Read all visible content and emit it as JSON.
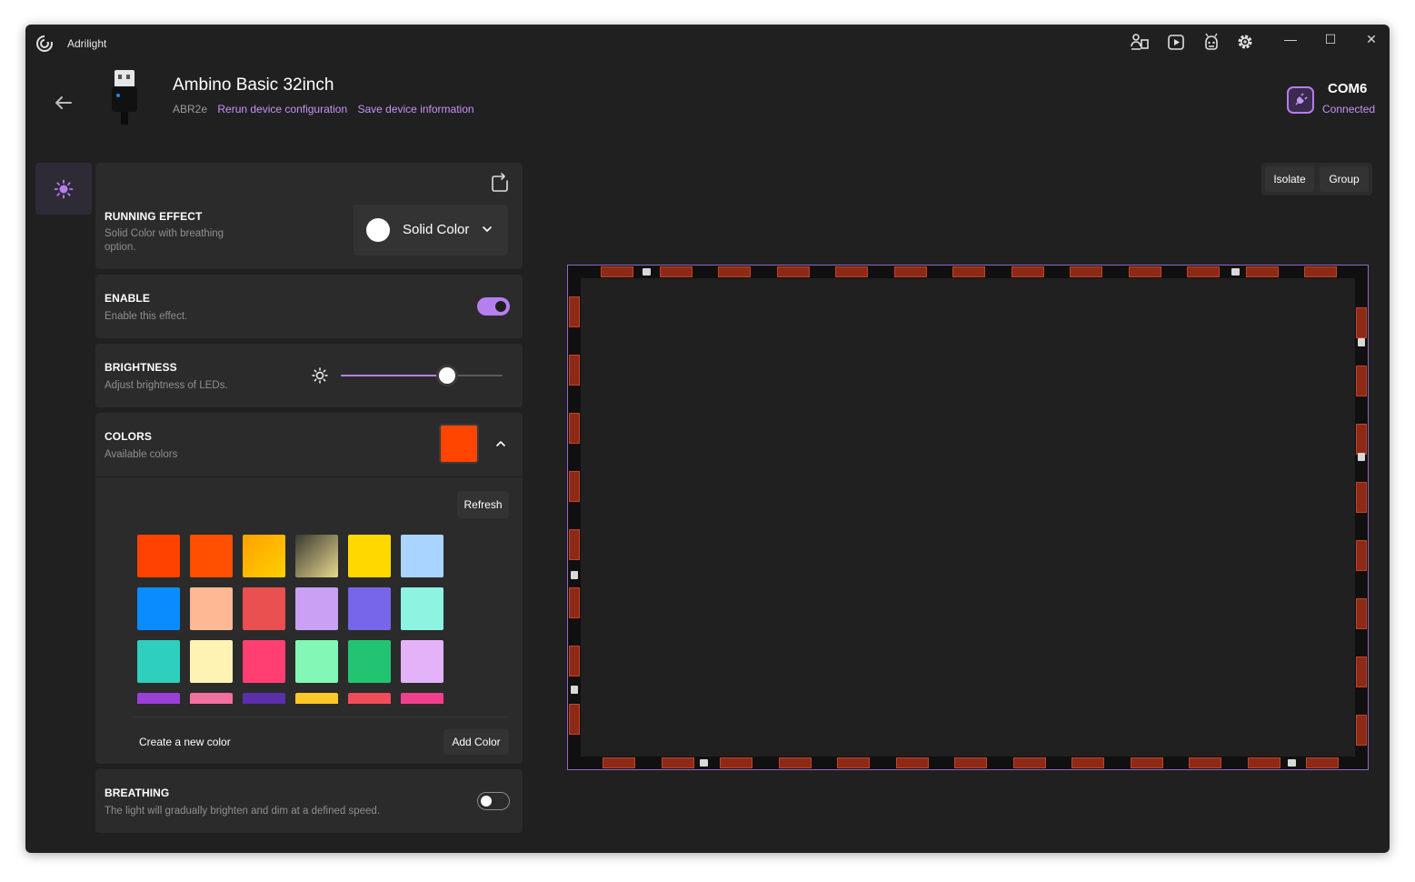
{
  "app": {
    "title": "Adrilight"
  },
  "titlebar": {
    "icons": [
      "device-config-icon",
      "media-play-icon",
      "android-icon",
      "settings-icon"
    ],
    "window_controls": {
      "minimize": "—",
      "maximize": "☐",
      "close": "✕"
    }
  },
  "device": {
    "name": "Ambino Basic 32inch",
    "code": "ABR2e",
    "rerun_link": "Rerun device configuration",
    "save_link": "Save device information",
    "port": "COM6",
    "status": "Connected"
  },
  "colors": {
    "accent": "#b67ff0",
    "link": "#c792f5",
    "selected_color": "#ff4500"
  },
  "running_effect": {
    "title": "RUNNING EFFECT",
    "description": "Solid Color with breathing option.",
    "selected": "Solid Color"
  },
  "enable": {
    "title": "ENABLE",
    "description": "Enable  this effect.",
    "value": true
  },
  "brightness": {
    "title": "BRIGHTNESS",
    "description": "Adjust brightness of LEDs.",
    "value_percent": 66
  },
  "colors_panel": {
    "title": "COLORS",
    "description": "Available colors",
    "refresh_label": "Refresh",
    "create_label": "Create a new color",
    "add_label": "Add Color",
    "palette": [
      "#ff4200",
      "#ff4f00",
      "linear-gradient(135deg,#ffa000,#ffd000)",
      "linear-gradient(135deg,#3a3a30,#e8d890)",
      "#ffd800",
      "#a8d4ff",
      "#0a8cff",
      "#ffb894",
      "#ea5050",
      "#c8a0f4",
      "#7866ea",
      "#8ef4e2",
      "#2ecfbe",
      "#fff3b4",
      "#ff3f72",
      "#82f7b6",
      "#22c472",
      "#e4b2f8",
      "#9a3fd8",
      "#f270a0",
      "#5a2fa8",
      "#ffc828",
      "#f04c5a",
      "#f0408c"
    ]
  },
  "breathing": {
    "title": "BREATHING",
    "description": "The light will gradually brighten and dim at a defined speed.",
    "value": false
  },
  "canvas_tools": {
    "isolate_label": "Isolate",
    "group_label": "Group"
  }
}
